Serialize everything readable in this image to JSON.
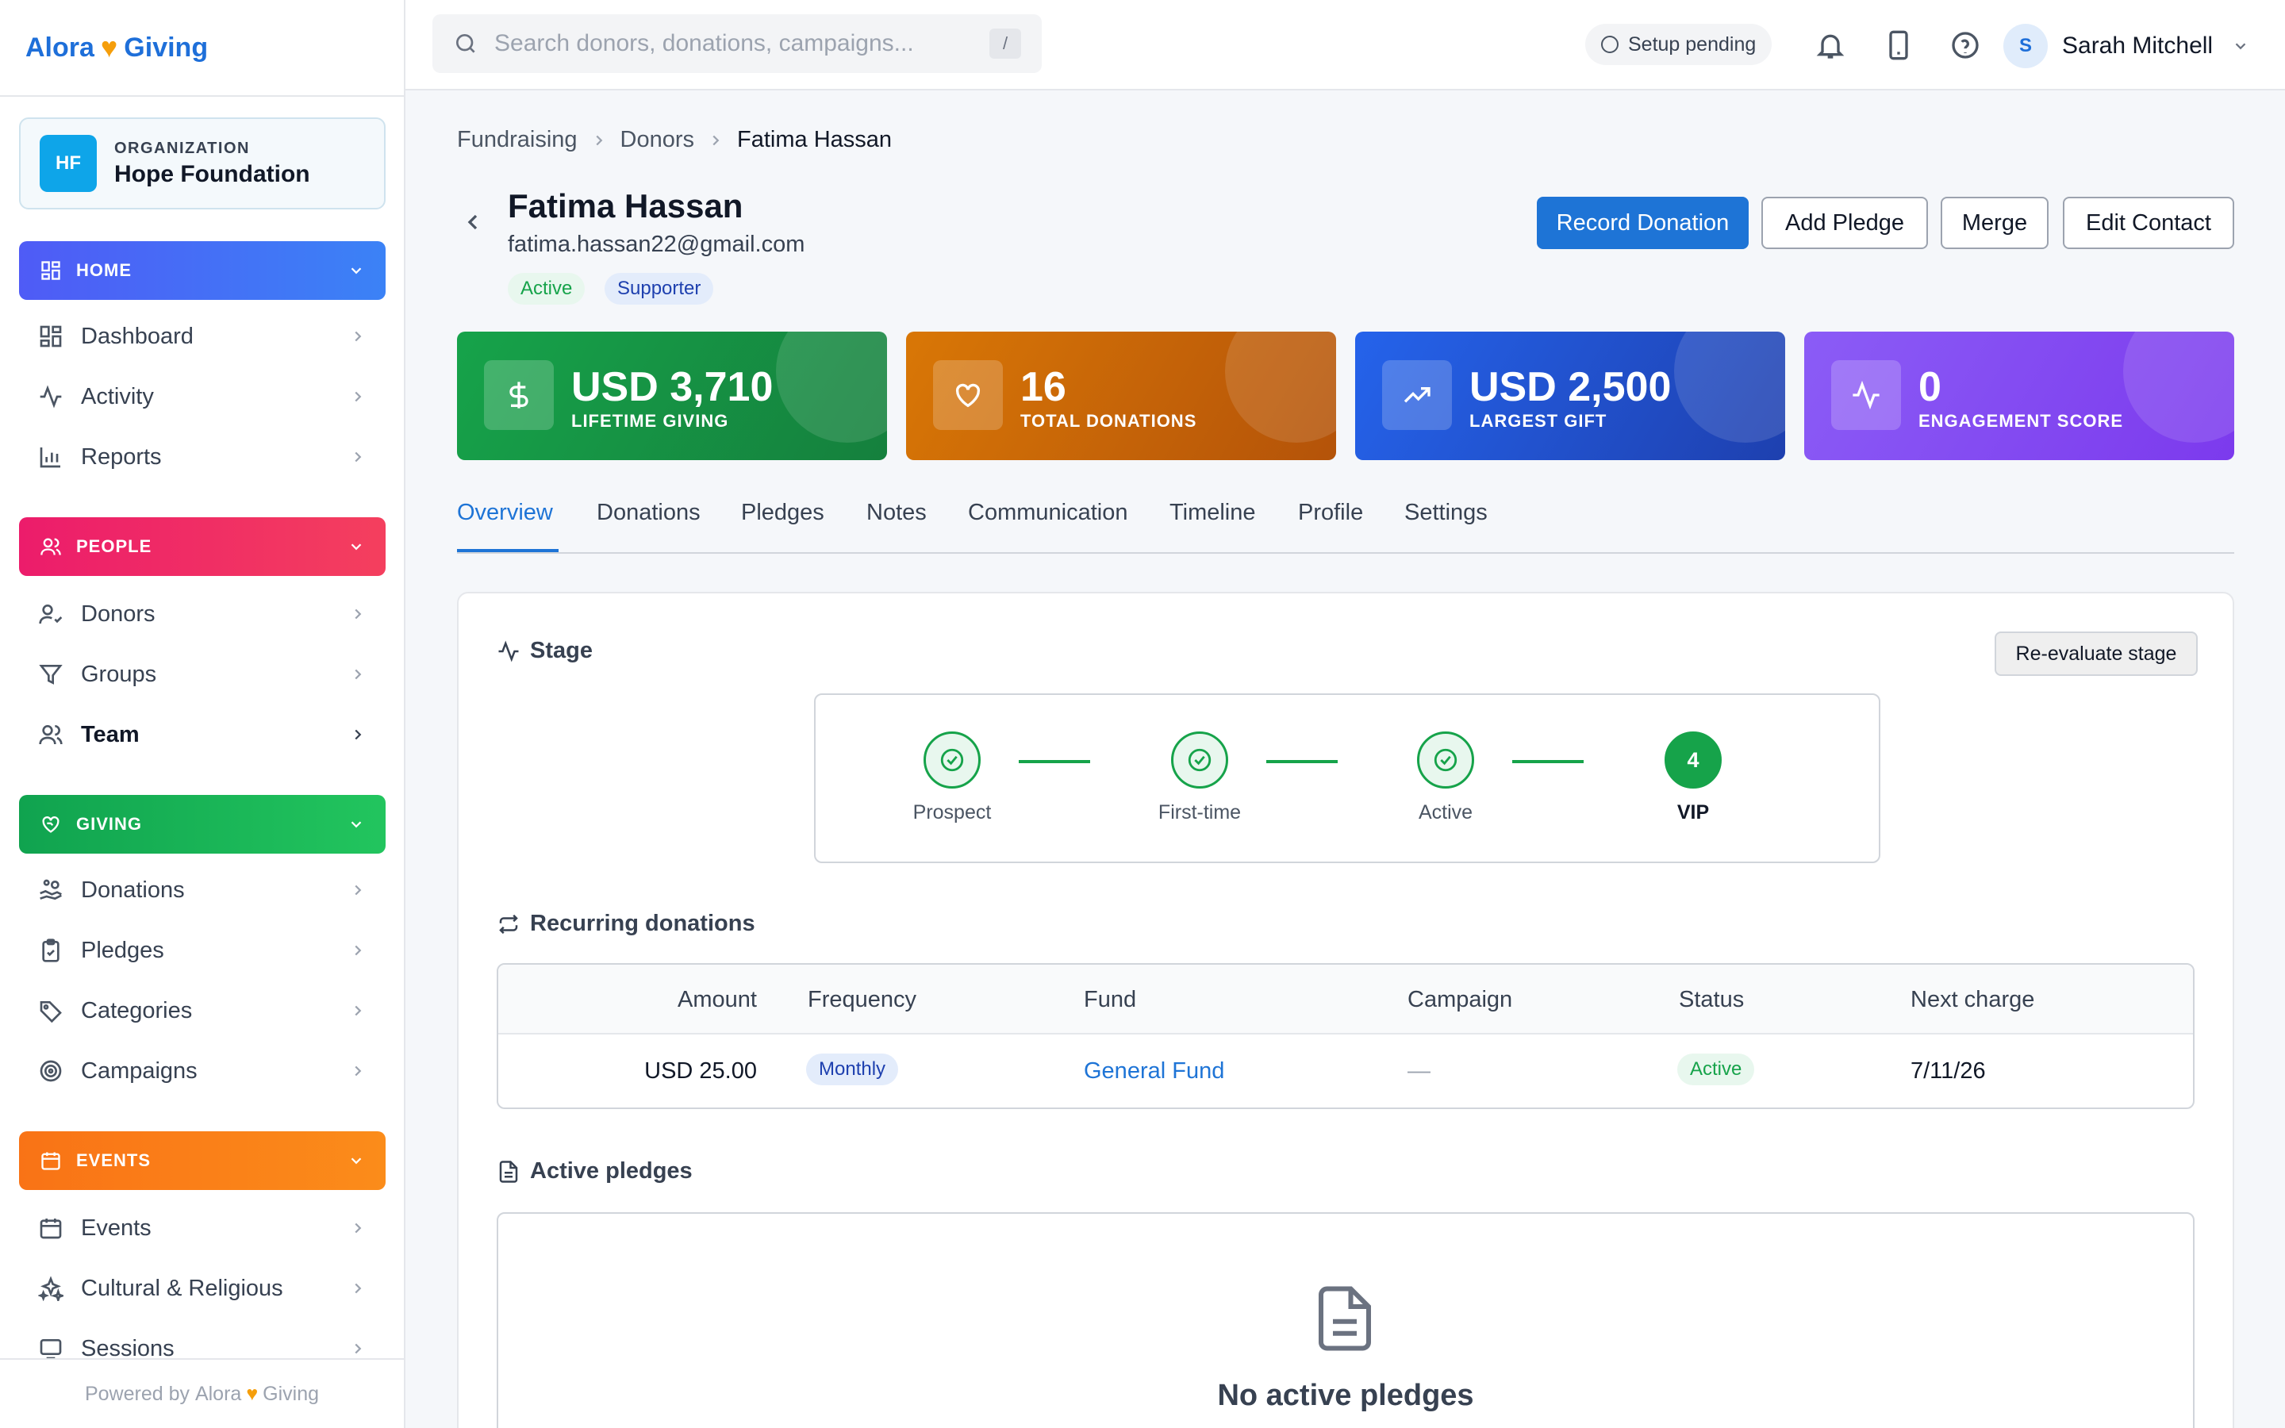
{
  "brand": {
    "name_left": "Alora",
    "name_right": "Giving",
    "heart": "♥"
  },
  "organization": {
    "label": "ORGANIZATION",
    "initials": "HF",
    "name": "Hope Foundation"
  },
  "sidebar": {
    "sections": [
      {
        "label": "HOME",
        "color": "#4f5bf6",
        "items": [
          "Dashboard",
          "Activity",
          "Reports"
        ]
      },
      {
        "label": "PEOPLE",
        "color": "#ec1c6b",
        "items": [
          "Donors",
          "Groups",
          "Team"
        ]
      },
      {
        "label": "GIVING",
        "color": "#10b35a",
        "items": [
          "Donations",
          "Pledges",
          "Categories",
          "Campaigns"
        ]
      },
      {
        "label": "EVENTS",
        "color": "#f97316",
        "items": [
          "Events",
          "Cultural & Religious",
          "Sessions"
        ]
      }
    ],
    "footer": {
      "prefix": "Powered by",
      "brand_left": "Alora",
      "brand_right": "Giving"
    }
  },
  "topbar": {
    "search_placeholder": "Search donors, donations, campaigns...",
    "search_shortcut": "/",
    "setup_status": "Setup pending",
    "user": {
      "initial": "S",
      "name": "Sarah Mitchell"
    }
  },
  "breadcrumb": [
    "Fundraising",
    "Donors",
    "Fatima Hassan"
  ],
  "contact": {
    "name": "Fatima Hassan",
    "email": "fatima.hassan22@gmail.com",
    "tags": [
      "Active",
      "Supporter"
    ]
  },
  "actions": [
    "Record Donation",
    "Add Pledge",
    "Merge",
    "Edit Contact"
  ],
  "stats": [
    {
      "value": "USD 3,710",
      "label": "LIFETIME GIVING",
      "icon": "dollar-icon",
      "color": "#16a34a"
    },
    {
      "value": "16",
      "label": "TOTAL DONATIONS",
      "icon": "heart-icon",
      "color": "#d97706"
    },
    {
      "value": "USD 2,500",
      "label": "LARGEST GIFT",
      "icon": "trending-up-icon",
      "color": "#2563eb"
    },
    {
      "value": "0",
      "label": "ENGAGEMENT SCORE",
      "icon": "activity-icon",
      "color": "#8b5cf6"
    }
  ],
  "tabs": [
    "Overview",
    "Donations",
    "Pledges",
    "Notes",
    "Communication",
    "Timeline",
    "Profile",
    "Settings"
  ],
  "active_tab": "Overview",
  "stage": {
    "title": "Stage",
    "reevaluate_label": "Re-evaluate stage",
    "steps": [
      {
        "name": "Prospect",
        "done": true
      },
      {
        "name": "First-time",
        "done": true
      },
      {
        "name": "Active",
        "done": true
      },
      {
        "name": "VIP",
        "done": false,
        "number": "4"
      }
    ]
  },
  "recurring": {
    "title": "Recurring donations",
    "columns": [
      "Amount",
      "Frequency",
      "Fund",
      "Campaign",
      "Status",
      "Next charge"
    ],
    "rows": [
      {
        "amount": "USD 25.00",
        "frequency": "Monthly",
        "fund": "General Fund",
        "campaign": "—",
        "status": "Active",
        "next_charge": "7/11/26"
      }
    ]
  },
  "pledges": {
    "title": "Active pledges",
    "empty_text": "No active pledges"
  }
}
